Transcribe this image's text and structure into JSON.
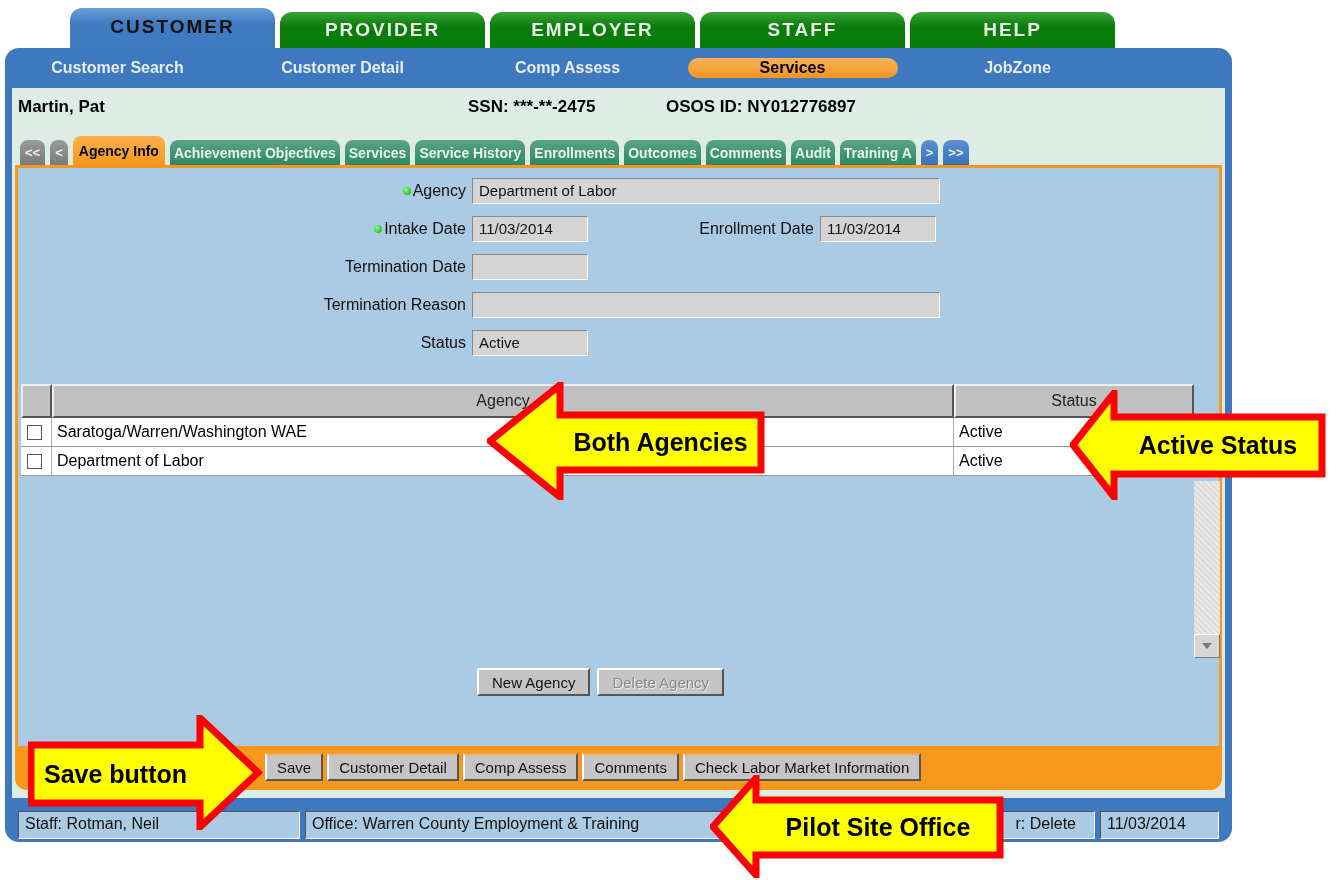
{
  "top_tabs": [
    {
      "label": "CUSTOMER",
      "selected": true
    },
    {
      "label": "PROVIDER",
      "selected": false
    },
    {
      "label": "EMPLOYER",
      "selected": false
    },
    {
      "label": "STAFF",
      "selected": false
    },
    {
      "label": "HELP",
      "selected": false
    }
  ],
  "nav": [
    {
      "label": "Customer Search",
      "selected": false
    },
    {
      "label": "Customer Detail",
      "selected": false
    },
    {
      "label": "Comp Assess",
      "selected": false
    },
    {
      "label": "Services",
      "selected": true
    },
    {
      "label": "JobZone",
      "selected": false
    }
  ],
  "customer": {
    "name": "Martin, Pat",
    "ssn": "SSN: ***-**-2475",
    "osos_id": "OSOS ID: NY012776897"
  },
  "sub_tabs": [
    {
      "label": "<<",
      "kind": "arrow",
      "selected": false
    },
    {
      "label": "<",
      "kind": "arrow",
      "selected": false
    },
    {
      "label": "Agency Info",
      "kind": "tab",
      "selected": true
    },
    {
      "label": "Achievement Objectives",
      "kind": "tab",
      "selected": false
    },
    {
      "label": "Services",
      "kind": "tab",
      "selected": false
    },
    {
      "label": "Service History",
      "kind": "tab",
      "selected": false
    },
    {
      "label": "Enrollments",
      "kind": "tab",
      "selected": false
    },
    {
      "label": "Outcomes",
      "kind": "tab",
      "selected": false
    },
    {
      "label": "Comments",
      "kind": "tab",
      "selected": false
    },
    {
      "label": "Audit",
      "kind": "tab",
      "selected": false
    },
    {
      "label": "Training A",
      "kind": "tab",
      "selected": false
    },
    {
      "label": ">",
      "kind": "arrow",
      "selected": false
    },
    {
      "label": ">>",
      "kind": "arrow",
      "selected": false
    }
  ],
  "form": [
    {
      "fields": [
        {
          "label": "Agency",
          "value": "Department of Labor",
          "required": true,
          "kind": "wide"
        }
      ]
    },
    {
      "fields": [
        {
          "label": "Intake Date",
          "value": "11/03/2014",
          "required": true,
          "kind": "date"
        },
        {
          "label": "Enrollment Date",
          "value": "11/03/2014",
          "required": false,
          "kind": "date"
        }
      ]
    },
    {
      "fields": [
        {
          "label": "Termination Date",
          "required": false,
          "kind": "date"
        }
      ]
    },
    {
      "fields": [
        {
          "label": "Termination Reason",
          "required": false,
          "kind": "wide"
        }
      ]
    },
    {
      "fields": [
        {
          "label": "Status",
          "value": "Active",
          "required": false,
          "kind": "date"
        }
      ]
    }
  ],
  "table": {
    "columns": [
      "Agency",
      "Status"
    ],
    "rows": [
      {
        "checked": false,
        "agency": "Saratoga/Warren/Washington WAE",
        "status": "Active"
      },
      {
        "checked": false,
        "agency": "Department of Labor",
        "status": "Active"
      }
    ]
  },
  "table_buttons": [
    {
      "label": "New Agency",
      "disabled": false
    },
    {
      "label": "Delete Agency",
      "disabled": true
    }
  ],
  "bottom_buttons": [
    "Save",
    "Customer Detail",
    "Comp Assess",
    "Comments",
    "Check Labor Market Information"
  ],
  "status_bar": [
    "Staff: Rotman, Neil",
    "Office: Warren County Employment & Training",
    "r: Delete",
    "11/03/2014"
  ],
  "callouts": [
    {
      "text": "Both Agencies",
      "kind": "left"
    },
    {
      "text": "Active Status",
      "kind": "left"
    },
    {
      "text": "Save button",
      "kind": "right"
    },
    {
      "text": "Pilot Site Office",
      "kind": "left"
    }
  ]
}
